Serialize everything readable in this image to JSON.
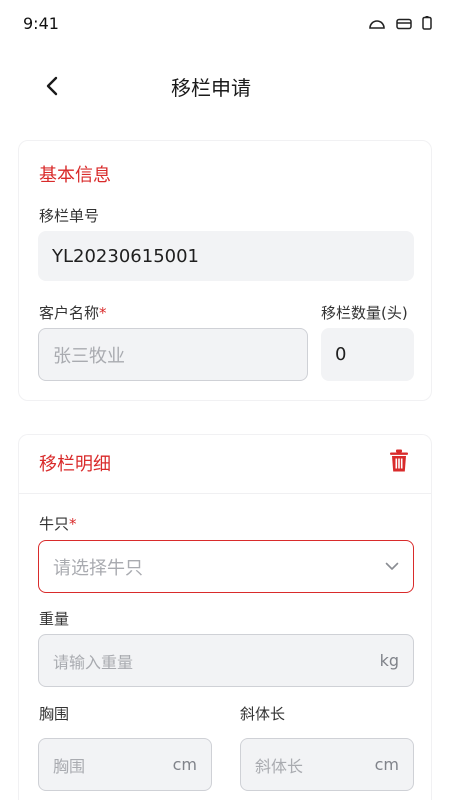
{
  "status_bar": {
    "time": "9:41"
  },
  "header": {
    "title": "移栏申请"
  },
  "basic_info": {
    "section_title": "基本信息",
    "order_no_label": "移栏单号",
    "order_no_value": "YL20230615001",
    "customer_label": "客户名称",
    "customer_required": "*",
    "customer_placeholder": "张三牧业",
    "quantity_label": "移栏数量(头)",
    "quantity_value": "0"
  },
  "detail": {
    "section_title": "移栏明细",
    "cattle_label": "牛只",
    "cattle_required": "*",
    "cattle_placeholder": "请选择牛只",
    "weight_label": "重量",
    "weight_placeholder": "请输入重量",
    "weight_unit": "kg",
    "chest_label": "胸围",
    "chest_placeholder": "胸围",
    "chest_unit": "cm",
    "body_length_label": "斜体长",
    "body_length_placeholder": "斜体长",
    "body_length_unit": "cm"
  },
  "colors": {
    "accent": "#d92b2b",
    "input_bg": "#f2f3f5",
    "placeholder": "#a9abb0"
  }
}
